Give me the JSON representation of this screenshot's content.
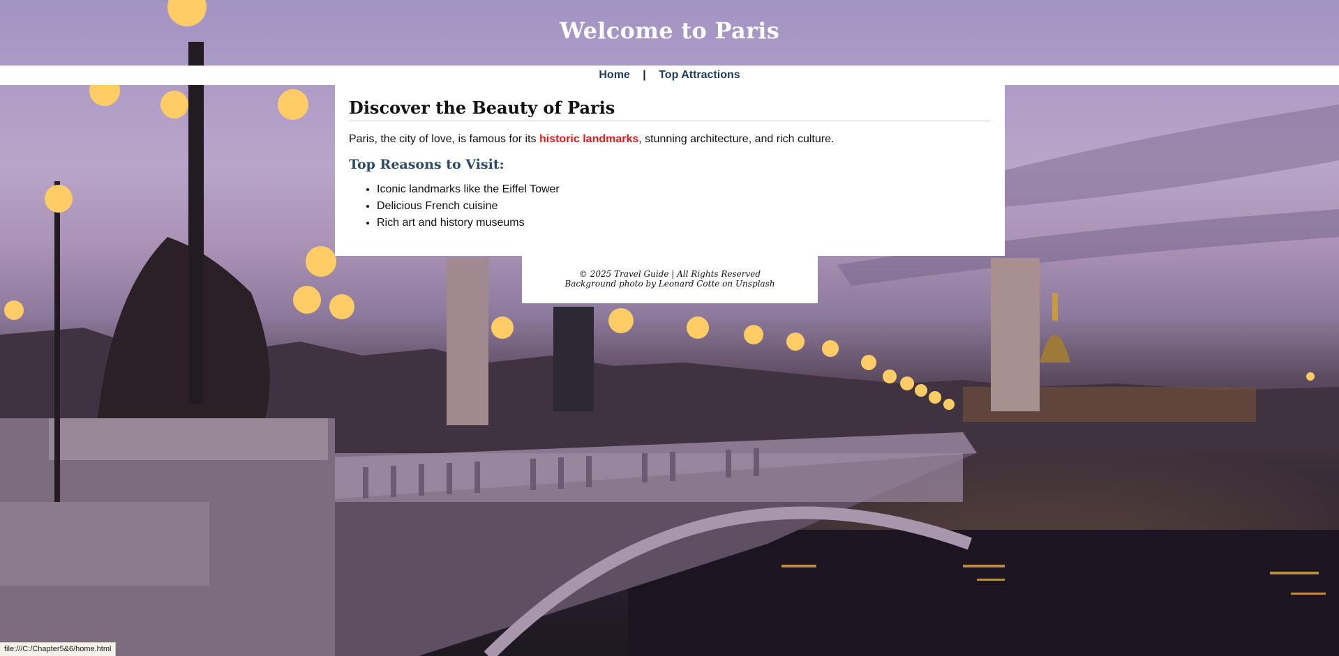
{
  "header": {
    "title": "Welcome to Paris"
  },
  "nav": {
    "items": [
      {
        "label": "Home"
      },
      {
        "label": "Top Attractions"
      }
    ],
    "separator": "|"
  },
  "main": {
    "heading": "Discover the Beauty of Paris",
    "intro": {
      "before": "Paris, the city of love, is famous for its ",
      "highlight": "historic landmarks",
      "after": ", stunning architecture, and rich culture."
    },
    "reasons_heading": "Top Reasons to Visit:",
    "reasons": [
      "Iconic landmarks like the Eiffel Tower",
      "Delicious French cuisine",
      "Rich art and history museums"
    ]
  },
  "footer": {
    "copyright": "© 2025 Travel Guide | All Rights Reserved",
    "credit": "Background photo by Leonard Cotte on Unsplash"
  },
  "status_bar": {
    "url": "file:///C:/Chapter5&6/home.html"
  },
  "colors": {
    "highlight": "#e11a1a",
    "nav_link": "#1f3b57",
    "subheading": "#2c4a66"
  },
  "background": {
    "description_icon": "paris-bridge-twilight-photo"
  }
}
